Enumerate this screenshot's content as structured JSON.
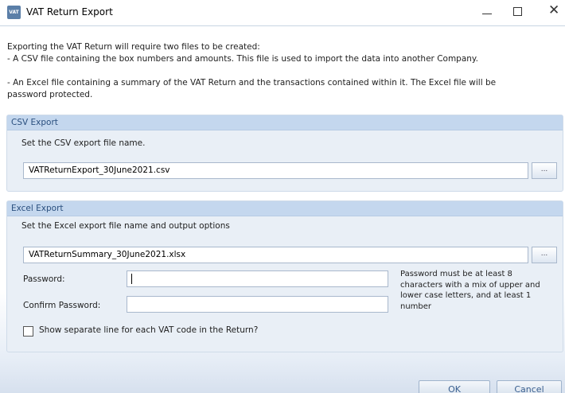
{
  "window": {
    "title": "VAT Return Export",
    "icon_text": "VAT",
    "controls": {
      "minimize": "minimize-icon",
      "maximize": "maximize-icon",
      "close": "close-icon"
    }
  },
  "intro": {
    "line1": "Exporting the VAT Return will require two files to be created:",
    "line2": " - A CSV file containing the box numbers and amounts. This file is used to import the data into another Company.",
    "line3": " - An Excel file containing a summary of the VAT Return and the transactions contained within it. The Excel file will be",
    "line4": "password protected."
  },
  "csv": {
    "header": "CSV Export",
    "label": "Set the CSV export file name.",
    "filename": "VATReturnExport_30June2021.csv",
    "browse": "..."
  },
  "excel": {
    "header": "Excel Export",
    "label": "Set the Excel export file name and output options",
    "filename": "VATReturnSummary_30June2021.xlsx",
    "browse": "...",
    "password_label": "Password:",
    "password_value": "",
    "confirm_label": "Confirm Password:",
    "confirm_value": "",
    "hint_line1": "Password must be at least 8",
    "hint_line2": "characters with a mix of upper and",
    "hint_line3": "lower case letters, and at least 1",
    "hint_line4": "number",
    "checkbox_label": "Show separate line for each VAT code in the Return?",
    "checkbox_checked": false
  },
  "buttons": {
    "ok": "OK",
    "cancel": "Cancel"
  },
  "colors": {
    "group_header": "#c4d7ee",
    "group_body": "#e9eff6",
    "header_text": "#2a4f7e"
  }
}
